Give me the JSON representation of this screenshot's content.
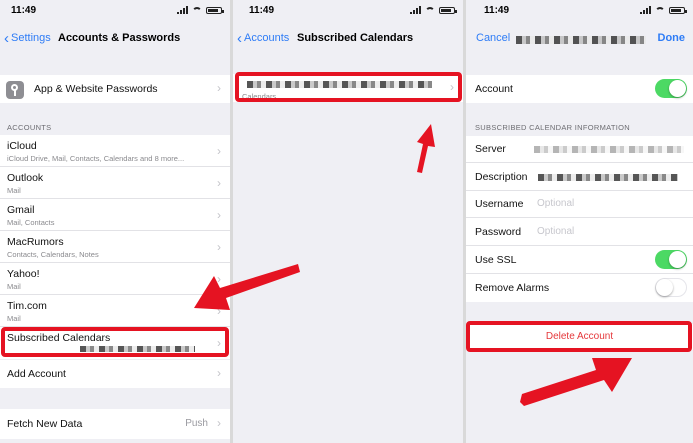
{
  "panel1": {
    "time": "11:49",
    "back_label": "Settings",
    "title": "Accounts & Passwords",
    "passwords_row": "App & Website Passwords",
    "section_accounts": "ACCOUNTS",
    "accounts": [
      {
        "label": "iCloud",
        "sub": "iCloud Drive, Mail, Contacts, Calendars and 8 more..."
      },
      {
        "label": "Outlook",
        "sub": "Mail"
      },
      {
        "label": "Gmail",
        "sub": "Mail, Contacts"
      },
      {
        "label": "MacRumors",
        "sub": "Contacts, Calendars, Notes"
      },
      {
        "label": "Yahoo!",
        "sub": "Mail"
      },
      {
        "label": "Tim.com",
        "sub": "Mail"
      },
      {
        "label": "Subscribed Calendars",
        "sub": ""
      }
    ],
    "add_account": "Add Account",
    "fetch_label": "Fetch New Data",
    "fetch_value": "Push"
  },
  "panel2": {
    "time": "11:49",
    "back_label": "Accounts",
    "title": "Subscribed Calendars",
    "row_sub": "Calendars"
  },
  "panel3": {
    "time": "11:49",
    "cancel_label": "Cancel",
    "done_label": "Done",
    "account_label": "Account",
    "account_on": true,
    "section_info": "SUBSCRIBED CALENDAR INFORMATION",
    "server_label": "Server",
    "description_label": "Description",
    "username_label": "Username",
    "username_placeholder": "Optional",
    "password_label": "Password",
    "password_placeholder": "Optional",
    "ssl_label": "Use SSL",
    "ssl_on": true,
    "alarms_label": "Remove Alarms",
    "alarms_on": false,
    "delete_label": "Delete Account"
  },
  "colors": {
    "accent": "#2e7cf6",
    "toggle_on": "#4cd964",
    "delete_red": "#e5383b",
    "highlight_red": "#e51322"
  }
}
